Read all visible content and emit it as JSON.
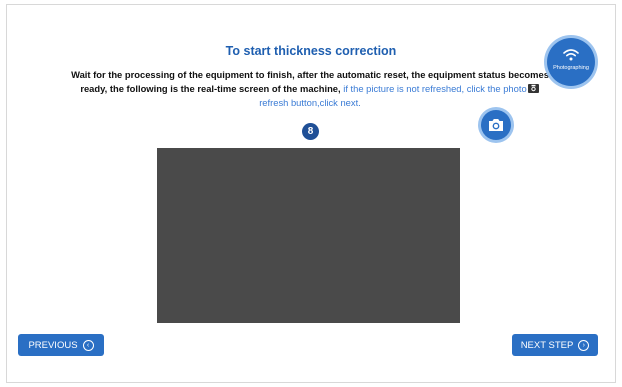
{
  "title": "To start thickness correction",
  "instructions": {
    "main_text": "Wait for the processing of the equipment to finish, after the automatic reset, the equipment status becomes ready, the following is the real-time screen of the machine, ",
    "highlight_before_icon": "if the picture is not refreshed, click the photo",
    "highlight_after_icon": " refresh button,click next."
  },
  "countdown": "8",
  "photo_button": {
    "label": "Photographing",
    "icon": "wifi-icon"
  },
  "refresh_button": {
    "icon": "camera-icon"
  },
  "nav": {
    "previous_label": "PREVIOUS",
    "next_label": "NEXT STEP"
  },
  "colors": {
    "accent": "#2a6fc4",
    "title": "#1f5fb0",
    "highlight": "#3a7bd5",
    "badge": "#1f4f96",
    "preview": "#4a4a4a"
  }
}
